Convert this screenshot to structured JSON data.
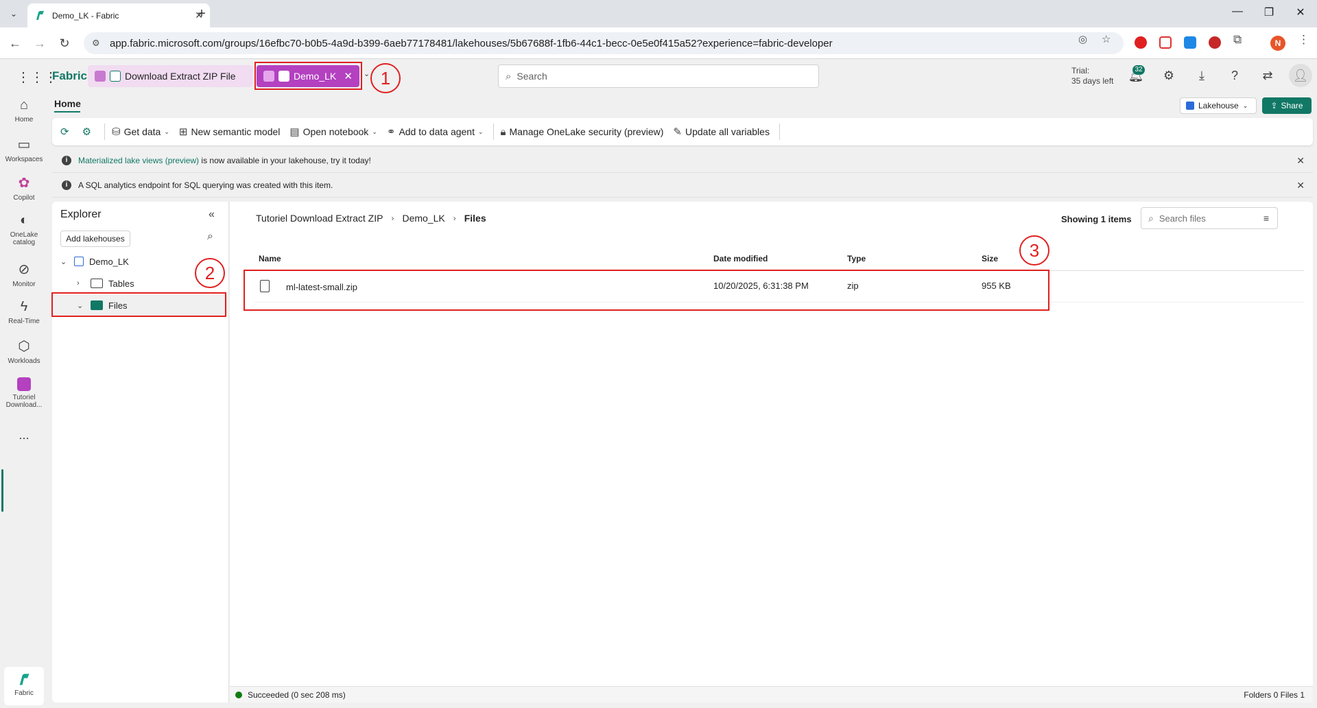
{
  "browser": {
    "tab_title": "Demo_LK - Fabric",
    "url": "app.fabric.microsoft.com/groups/16efbc70-b0b5-4a9d-b399-6aeb77178481/lakehouses/5b67688f-1fb6-44c1-becc-0e5e0f415a52?experience=fabric-developer",
    "profile_initial": "N"
  },
  "app": {
    "brand": "Fabric",
    "open_items": [
      {
        "label": "Download Extract ZIP File"
      },
      {
        "label": "Demo_LK"
      }
    ],
    "search_placeholder": "Search",
    "trial_line1": "Trial:",
    "trial_line2": "35 days left",
    "notification_count": "32"
  },
  "annotations": [
    "1",
    "2",
    "3"
  ],
  "rail": {
    "items": [
      {
        "label": "Home"
      },
      {
        "label": "Workspaces"
      },
      {
        "label": "Copilot"
      },
      {
        "label": "OneLake",
        "label2": "catalog"
      },
      {
        "label": "Monitor"
      },
      {
        "label": "Real-Time"
      },
      {
        "label": "Workloads"
      },
      {
        "label": "Tutoriel",
        "label2": "Download..."
      }
    ],
    "more": "...",
    "bottom_label": "Fabric"
  },
  "header": {
    "home_tab": "Home",
    "lakehouse_dropdown": "Lakehouse",
    "share": "Share"
  },
  "ribbon": {
    "get_data": "Get data",
    "new_semantic_model": "New semantic model",
    "open_notebook": "Open notebook",
    "add_to_data_agent": "Add to data agent",
    "manage_security": "Manage OneLake security (preview)",
    "update_variables": "Update all variables"
  },
  "banners": {
    "b1_link": "Materialized lake views (preview)",
    "b1_text": " is now available in your lakehouse, try it today!",
    "b2_text": "A SQL analytics endpoint for SQL querying was created with this item."
  },
  "explorer": {
    "title": "Explorer",
    "add_lakehouses": "Add lakehouses",
    "root": "Demo_LK",
    "tables": "Tables",
    "files": "Files"
  },
  "files_view": {
    "breadcrumb": [
      "Tutoriel Download Extract ZIP",
      "Demo_LK",
      "Files"
    ],
    "showing": "Showing 1 items",
    "search_placeholder": "Search files",
    "columns": {
      "name": "Name",
      "date": "Date modified",
      "type": "Type",
      "size": "Size"
    },
    "rows": [
      {
        "name": "ml-latest-small.zip",
        "date": "10/20/2025, 6:31:38 PM",
        "type": "zip",
        "size": "955 KB"
      }
    ]
  },
  "status": {
    "message": "Succeeded (0 sec 208 ms)",
    "counts": "Folders 0 Files 1"
  },
  "colors": {
    "accent": "#117865",
    "item_tab_active": "#b441c0",
    "annotation": "#e02020"
  }
}
